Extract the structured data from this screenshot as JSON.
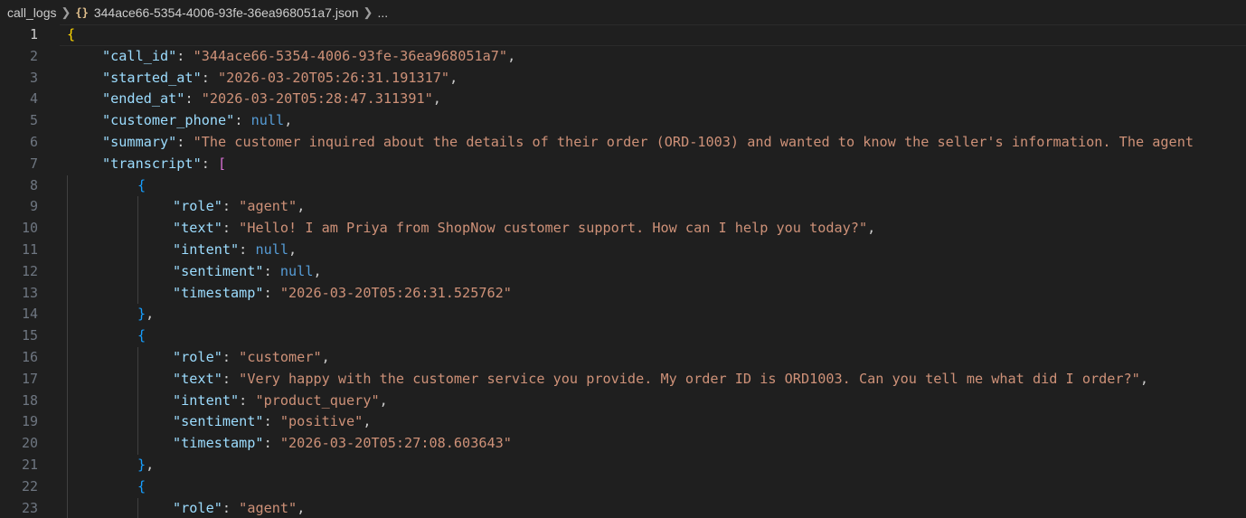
{
  "breadcrumb": {
    "folder": "call_logs",
    "file_icon": "{}",
    "file": "344ace66-5354-4006-93fe-36ea968051a7.json",
    "more": "..."
  },
  "colors": {
    "background": "#1f1f1f",
    "key": "#9cdcfe",
    "string": "#ce9178",
    "keyword": "#569cd6",
    "bracket_level1": "#ffd700",
    "bracket_level2": "#da70d6",
    "bracket_level3": "#179fff"
  },
  "editor": {
    "current_line": 1,
    "lines": [
      {
        "n": "1",
        "indent": 0,
        "tokens": [
          {
            "t": "{",
            "c": "b1"
          }
        ]
      },
      {
        "n": "2",
        "indent": 1,
        "tokens": [
          {
            "t": "\"call_id\"",
            "c": "key"
          },
          {
            "t": ": ",
            "c": "punc"
          },
          {
            "t": "\"344ace66-5354-4006-93fe-36ea968051a7\"",
            "c": "str"
          },
          {
            "t": ",",
            "c": "punc"
          }
        ]
      },
      {
        "n": "3",
        "indent": 1,
        "tokens": [
          {
            "t": "\"started_at\"",
            "c": "key"
          },
          {
            "t": ": ",
            "c": "punc"
          },
          {
            "t": "\"2026-03-20T05:26:31.191317\"",
            "c": "str"
          },
          {
            "t": ",",
            "c": "punc"
          }
        ]
      },
      {
        "n": "4",
        "indent": 1,
        "tokens": [
          {
            "t": "\"ended_at\"",
            "c": "key"
          },
          {
            "t": ": ",
            "c": "punc"
          },
          {
            "t": "\"2026-03-20T05:28:47.311391\"",
            "c": "str"
          },
          {
            "t": ",",
            "c": "punc"
          }
        ]
      },
      {
        "n": "5",
        "indent": 1,
        "tokens": [
          {
            "t": "\"customer_phone\"",
            "c": "key"
          },
          {
            "t": ": ",
            "c": "punc"
          },
          {
            "t": "null",
            "c": "kw"
          },
          {
            "t": ",",
            "c": "punc"
          }
        ]
      },
      {
        "n": "6",
        "indent": 1,
        "tokens": [
          {
            "t": "\"summary\"",
            "c": "key"
          },
          {
            "t": ": ",
            "c": "punc"
          },
          {
            "t": "\"The customer inquired about the details of their order (ORD-1003) and wanted to know the seller's information. The agent",
            "c": "str"
          }
        ]
      },
      {
        "n": "7",
        "indent": 1,
        "tokens": [
          {
            "t": "\"transcript\"",
            "c": "key"
          },
          {
            "t": ": ",
            "c": "punc"
          },
          {
            "t": "[",
            "c": "b2"
          }
        ]
      },
      {
        "n": "8",
        "indent": 2,
        "tokens": [
          {
            "t": "{",
            "c": "b3"
          }
        ]
      },
      {
        "n": "9",
        "indent": 3,
        "tokens": [
          {
            "t": "\"role\"",
            "c": "key"
          },
          {
            "t": ": ",
            "c": "punc"
          },
          {
            "t": "\"agent\"",
            "c": "str"
          },
          {
            "t": ",",
            "c": "punc"
          }
        ]
      },
      {
        "n": "10",
        "indent": 3,
        "tokens": [
          {
            "t": "\"text\"",
            "c": "key"
          },
          {
            "t": ": ",
            "c": "punc"
          },
          {
            "t": "\"Hello! I am Priya from ShopNow customer support. How can I help you today?\"",
            "c": "str"
          },
          {
            "t": ",",
            "c": "punc"
          }
        ]
      },
      {
        "n": "11",
        "indent": 3,
        "tokens": [
          {
            "t": "\"intent\"",
            "c": "key"
          },
          {
            "t": ": ",
            "c": "punc"
          },
          {
            "t": "null",
            "c": "kw"
          },
          {
            "t": ",",
            "c": "punc"
          }
        ]
      },
      {
        "n": "12",
        "indent": 3,
        "tokens": [
          {
            "t": "\"sentiment\"",
            "c": "key"
          },
          {
            "t": ": ",
            "c": "punc"
          },
          {
            "t": "null",
            "c": "kw"
          },
          {
            "t": ",",
            "c": "punc"
          }
        ]
      },
      {
        "n": "13",
        "indent": 3,
        "tokens": [
          {
            "t": "\"timestamp\"",
            "c": "key"
          },
          {
            "t": ": ",
            "c": "punc"
          },
          {
            "t": "\"2026-03-20T05:26:31.525762\"",
            "c": "str"
          }
        ]
      },
      {
        "n": "14",
        "indent": 2,
        "tokens": [
          {
            "t": "}",
            "c": "b3"
          },
          {
            "t": ",",
            "c": "punc"
          }
        ]
      },
      {
        "n": "15",
        "indent": 2,
        "tokens": [
          {
            "t": "{",
            "c": "b3"
          }
        ]
      },
      {
        "n": "16",
        "indent": 3,
        "tokens": [
          {
            "t": "\"role\"",
            "c": "key"
          },
          {
            "t": ": ",
            "c": "punc"
          },
          {
            "t": "\"customer\"",
            "c": "str"
          },
          {
            "t": ",",
            "c": "punc"
          }
        ]
      },
      {
        "n": "17",
        "indent": 3,
        "tokens": [
          {
            "t": "\"text\"",
            "c": "key"
          },
          {
            "t": ": ",
            "c": "punc"
          },
          {
            "t": "\"Very happy with the customer service you provide. My order ID is ORD1003. Can you tell me what did I order?\"",
            "c": "str"
          },
          {
            "t": ",",
            "c": "punc"
          }
        ]
      },
      {
        "n": "18",
        "indent": 3,
        "tokens": [
          {
            "t": "\"intent\"",
            "c": "key"
          },
          {
            "t": ": ",
            "c": "punc"
          },
          {
            "t": "\"product_query\"",
            "c": "str"
          },
          {
            "t": ",",
            "c": "punc"
          }
        ]
      },
      {
        "n": "19",
        "indent": 3,
        "tokens": [
          {
            "t": "\"sentiment\"",
            "c": "key"
          },
          {
            "t": ": ",
            "c": "punc"
          },
          {
            "t": "\"positive\"",
            "c": "str"
          },
          {
            "t": ",",
            "c": "punc"
          }
        ]
      },
      {
        "n": "20",
        "indent": 3,
        "tokens": [
          {
            "t": "\"timestamp\"",
            "c": "key"
          },
          {
            "t": ": ",
            "c": "punc"
          },
          {
            "t": "\"2026-03-20T05:27:08.603643\"",
            "c": "str"
          }
        ]
      },
      {
        "n": "21",
        "indent": 2,
        "tokens": [
          {
            "t": "}",
            "c": "b3"
          },
          {
            "t": ",",
            "c": "punc"
          }
        ]
      },
      {
        "n": "22",
        "indent": 2,
        "tokens": [
          {
            "t": "{",
            "c": "b3"
          }
        ]
      },
      {
        "n": "23",
        "indent": 3,
        "tokens": [
          {
            "t": "\"role\"",
            "c": "key"
          },
          {
            "t": ": ",
            "c": "punc"
          },
          {
            "t": "\"agent\"",
            "c": "str"
          },
          {
            "t": ",",
            "c": "punc"
          }
        ]
      }
    ]
  }
}
